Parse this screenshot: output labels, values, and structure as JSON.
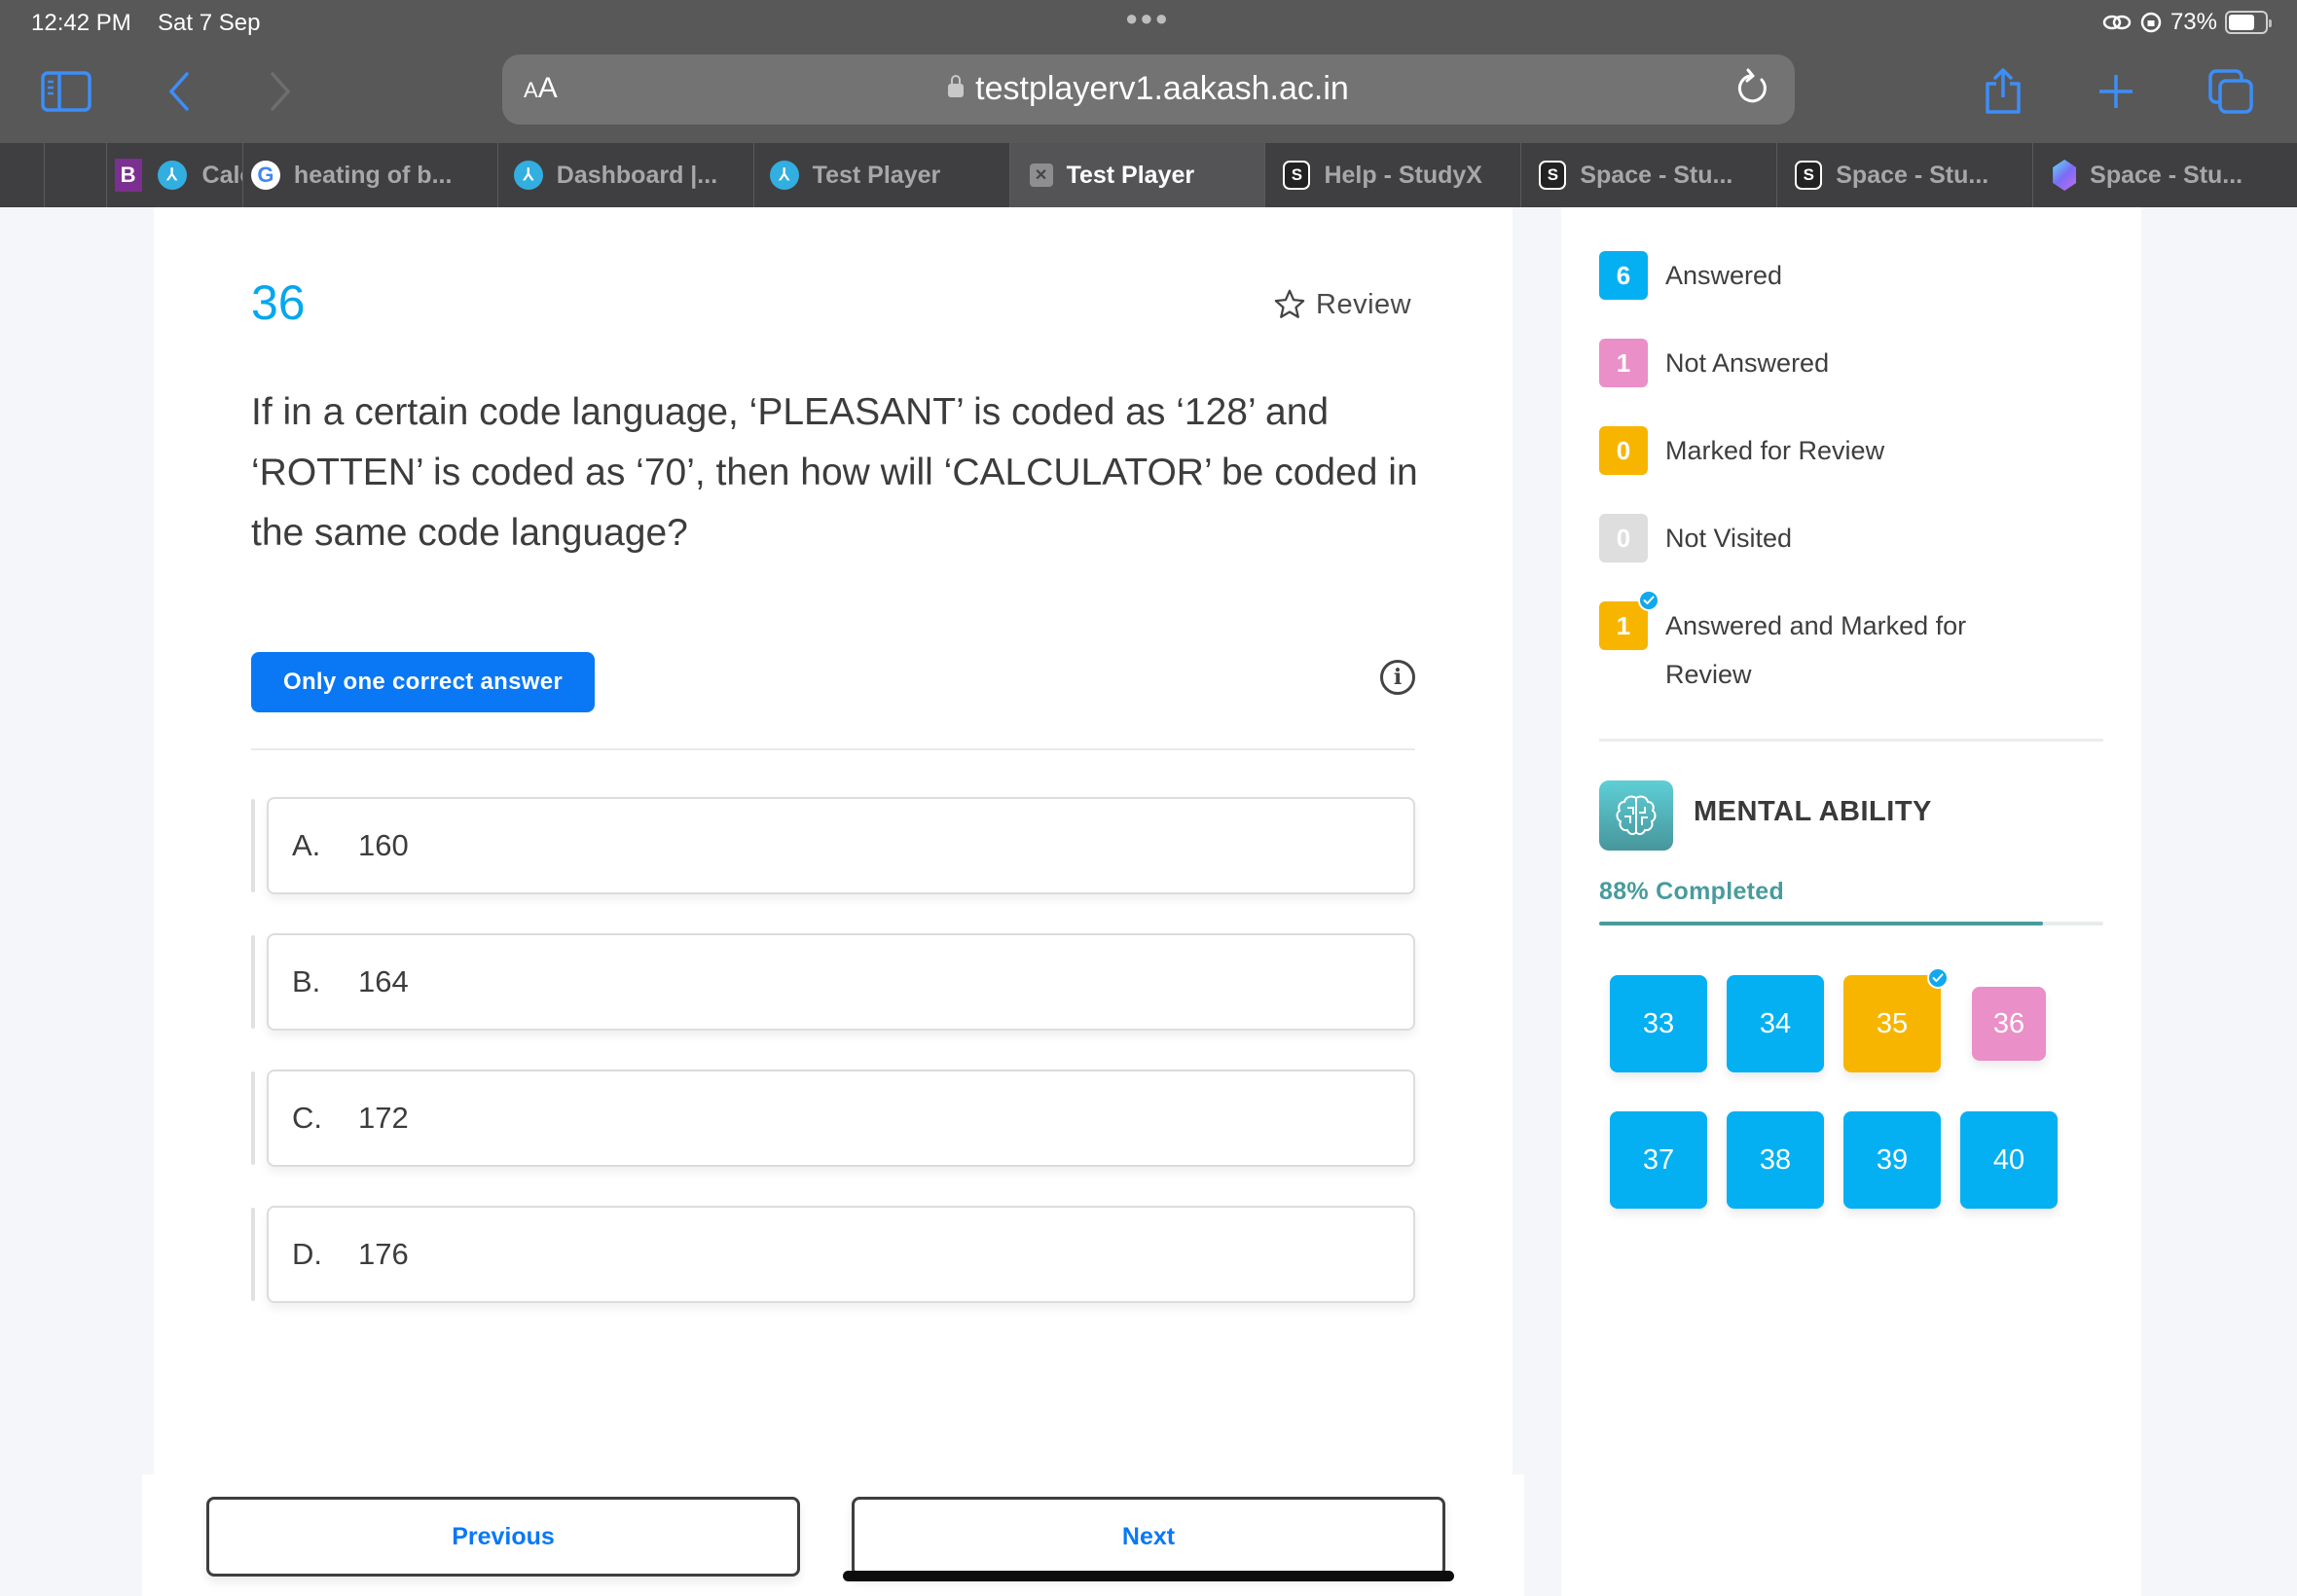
{
  "status_bar": {
    "time": "12:42 PM",
    "date": "Sat 7 Sep",
    "battery_percent": "73%",
    "battery_level": 0.73
  },
  "browser": {
    "text_size_label": "AA",
    "url": "testplayerv1.aakash.ac.in",
    "tabs": [
      {
        "label": "",
        "favicon": "byjus-icon",
        "active": false
      },
      {
        "label": "Calci",
        "favicon": "aakash-icon",
        "active": false
      },
      {
        "label": "heating of b...",
        "favicon": "google-icon",
        "active": false
      },
      {
        "label": "Dashboard |...",
        "favicon": "aakash-icon",
        "active": false
      },
      {
        "label": "Test Player",
        "favicon": "aakash-icon",
        "active": false
      },
      {
        "label": "Test Player",
        "favicon": "close-tab-icon",
        "active": true
      },
      {
        "label": "Help - StudyX",
        "favicon": "studyx-icon",
        "active": false
      },
      {
        "label": "Space - Stu...",
        "favicon": "studyx-icon",
        "active": false
      },
      {
        "label": "Space - Stu...",
        "favicon": "studyx-icon",
        "active": false
      },
      {
        "label": "Space - Stu...",
        "favicon": "gem-icon",
        "active": false
      }
    ]
  },
  "question": {
    "number": "36",
    "review_label": "Review",
    "text": "If in a certain code language, ‘PLEASANT’ is coded as ‘128’ and ‘ROTTEN’ is coded as ‘70’, then how will ‘CALCULATOR’ be coded in the same code language?",
    "type_label": "Only one correct answer",
    "options": [
      {
        "letter": "A.",
        "value": "160"
      },
      {
        "letter": "B.",
        "value": "164"
      },
      {
        "letter": "C.",
        "value": "172"
      },
      {
        "letter": "D.",
        "value": "176"
      }
    ]
  },
  "navigation": {
    "previous_label": "Previous",
    "next_label": "Next"
  },
  "legend": [
    {
      "count": "6",
      "label": "Answered",
      "color": "#05b0f2",
      "checked": false
    },
    {
      "count": "1",
      "label": "Not Answered",
      "color": "#ea8fc7",
      "checked": false
    },
    {
      "count": "0",
      "label": "Marked for Review",
      "color": "#f7b500",
      "checked": false
    },
    {
      "count": "0",
      "label": "Not Visited",
      "color": "#dedede",
      "checked": false
    },
    {
      "count": "1",
      "label": "Answered and Marked for Review",
      "color": "#f7b500",
      "checked": true
    }
  ],
  "section": {
    "title": "MENTAL ABILITY",
    "progress_label": "88% Completed",
    "progress_fraction": 0.88,
    "accent_color": "#489b9d"
  },
  "question_palette": [
    {
      "number": "33",
      "status": "answered",
      "color": "#05b0f2",
      "checked": false,
      "current": false
    },
    {
      "number": "34",
      "status": "answered",
      "color": "#05b0f2",
      "checked": false,
      "current": false
    },
    {
      "number": "35",
      "status": "answered-marked",
      "color": "#f7b500",
      "checked": true,
      "current": false
    },
    {
      "number": "36",
      "status": "not-answered",
      "color": "#ea8fc7",
      "checked": false,
      "current": true
    },
    {
      "number": "37",
      "status": "answered",
      "color": "#05b0f2",
      "checked": false,
      "current": false
    },
    {
      "number": "38",
      "status": "answered",
      "color": "#05b0f2",
      "checked": false,
      "current": false
    },
    {
      "number": "39",
      "status": "answered",
      "color": "#05b0f2",
      "checked": false,
      "current": false
    },
    {
      "number": "40",
      "status": "answered",
      "color": "#05b0f2",
      "checked": false,
      "current": false
    }
  ]
}
